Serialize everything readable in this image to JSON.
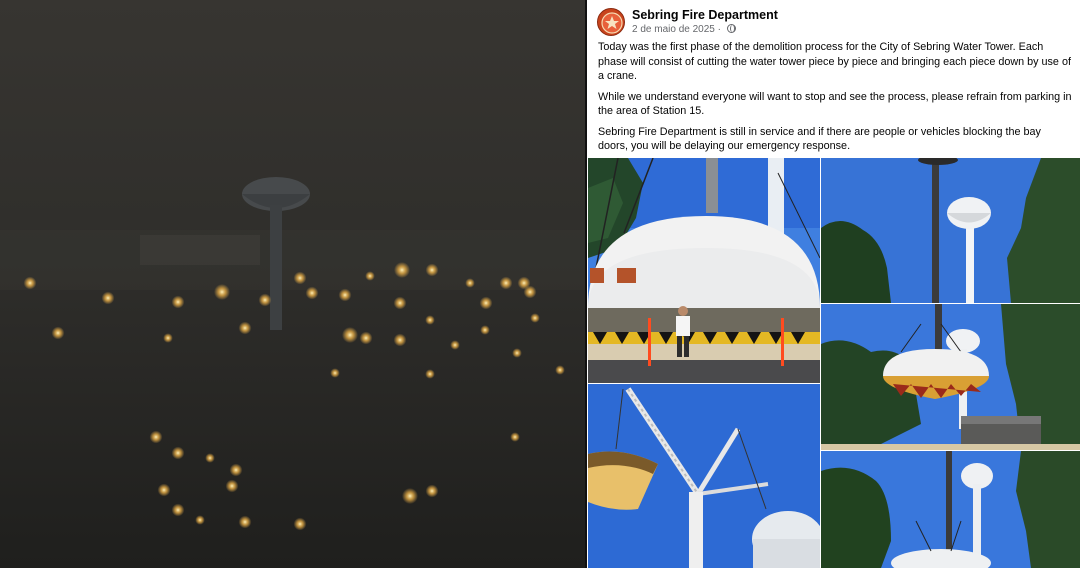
{
  "post": {
    "page_name": "Sebring Fire Department",
    "date": "2 de maio de 2025",
    "separator": "·",
    "paragraphs": [
      "Today was the first phase of the demolition process for the City of Sebring Water Tower. Each phase will consist of cutting the water tower piece by piece and bringing each piece down by use of a crane.",
      "While we understand everyone will want to stop and see the process, please refrain from parking in the area of Station 15.",
      "Sebring Fire Department is still in service and if there are people or vehicles blocking the bay doors, you will be delaying our emergency response."
    ],
    "icons": {
      "avatar": "fire-department-logo",
      "privacy": "globe-icon"
    }
  },
  "colors": {
    "sky": "#2f6bd6",
    "dome": "#f2f2f2",
    "night": "#2b2a27",
    "accent": "#c8431c"
  }
}
